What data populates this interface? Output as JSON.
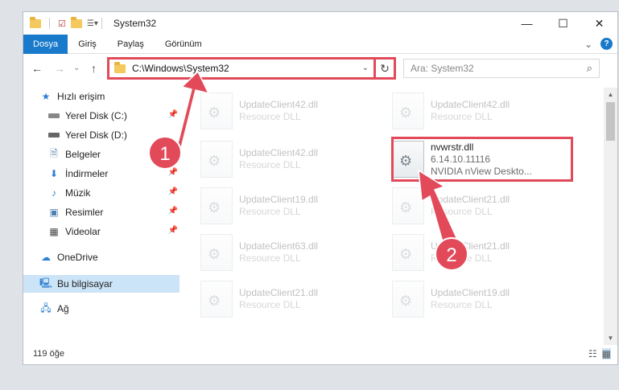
{
  "window": {
    "title": "System32"
  },
  "titlebar": {
    "minimize": "—",
    "maximize": "☐",
    "close": "✕"
  },
  "ribbon": {
    "tabs": [
      "Dosya",
      "Giriş",
      "Paylaş",
      "Görünüm"
    ],
    "expand": "⌄",
    "help": "?"
  },
  "nav": {
    "back": "←",
    "forward": "→",
    "recent": "⌄",
    "up": "↑",
    "address": "C:\\Windows\\System32",
    "address_dropdown": "⌄",
    "refresh": "↻",
    "search_placeholder": "Ara: System32",
    "search_icon": "⌕"
  },
  "sidebar": {
    "items": [
      {
        "label": "Hızlı erişim",
        "icon": "star-icon"
      },
      {
        "label": "Yerel Disk (C:)",
        "icon": "drive-icon",
        "pinned": true
      },
      {
        "label": "Yerel Disk (D:)",
        "icon": "drive-icon"
      },
      {
        "label": "Belgeler",
        "icon": "documents-icon"
      },
      {
        "label": "İndirmeler",
        "icon": "download-icon",
        "pinned": true
      },
      {
        "label": "Müzik",
        "icon": "music-icon",
        "pinned": true
      },
      {
        "label": "Resimler",
        "icon": "pictures-icon",
        "pinned": true
      },
      {
        "label": "Videolar",
        "icon": "video-icon",
        "pinned": true
      },
      {
        "label": "OneDrive",
        "icon": "cloud-icon"
      },
      {
        "label": "Bu bilgisayar",
        "icon": "computer-icon",
        "selected": true
      },
      {
        "label": "Ağ",
        "icon": "network-icon"
      }
    ]
  },
  "files": {
    "left": [
      {
        "name": "UpdateClient42.dll",
        "type": "Resource DLL"
      },
      {
        "name": "UpdateClient42.dll",
        "type": "Resource DLL"
      },
      {
        "name": "UpdateClient19.dll",
        "type": "Resource DLL"
      },
      {
        "name": "UpdateClient63.dll",
        "type": "Resource DLL"
      },
      {
        "name": "UpdateClient21.dll",
        "type": "Resource DLL"
      }
    ],
    "right": [
      {
        "name": "UpdateClient42.dll",
        "type": "Resource DLL"
      },
      {
        "name": "UpdateClient21.dll",
        "type": "Resource DLL"
      },
      {
        "name": "UpdateClient21.dll",
        "type": "Resource DLL"
      },
      {
        "name": "UpdateClient19.dll",
        "type": "Resource DLL"
      }
    ],
    "highlighted": {
      "name": "nvwrstr.dll",
      "version": "6.14.10.11116",
      "description": "NVIDIA nView Deskto..."
    }
  },
  "status": {
    "count": "119 öğe"
  },
  "annotations": {
    "badge1": "1",
    "badge2": "2",
    "color": "#e24a5a"
  }
}
